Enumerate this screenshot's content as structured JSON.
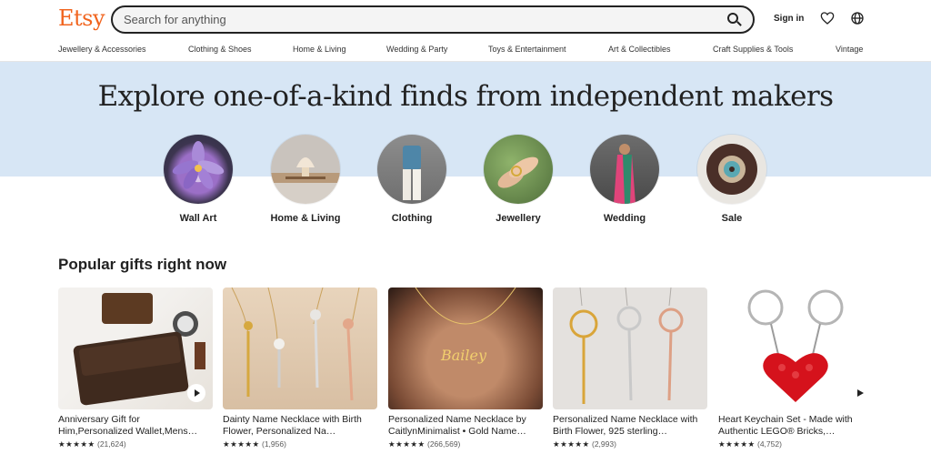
{
  "header": {
    "logo": "Etsy",
    "search_placeholder": "Search for anything",
    "sign_in": "Sign in"
  },
  "nav": [
    "Jewellery & Accessories",
    "Clothing & Shoes",
    "Home & Living",
    "Wedding & Party",
    "Toys & Entertainment",
    "Art & Collectibles",
    "Craft Supplies & Tools",
    "Vintage"
  ],
  "hero": {
    "title": "Explore one-of-a-kind finds from independent makers",
    "categories": [
      "Wall Art",
      "Home & Living",
      "Clothing",
      "Jewellery",
      "Wedding",
      "Sale"
    ]
  },
  "popular": {
    "title": "Popular gifts right now",
    "items": [
      {
        "title": "Anniversary Gift for Him,Personalized Wallet,Mens…",
        "stars": "★★★★★",
        "count": "(21,624)"
      },
      {
        "title": "Dainty Name Necklace with Birth Flower, Personalized Na…",
        "stars": "★★★★★",
        "count": "(1,956)"
      },
      {
        "title": "Personalized Name Necklace by CaitlynMinimalist • Gold Name…",
        "stars": "★★★★★",
        "count": "(266,569)"
      },
      {
        "title": "Personalized Name Necklace with Birth Flower, 925 sterling…",
        "stars": "★★★★★",
        "count": "(2,993)"
      },
      {
        "title": "Heart Keychain Set - Made with Authentic LEGO® Bricks,…",
        "stars": "★★★★★",
        "count": "(4,752)"
      }
    ]
  },
  "colors": {
    "brand": "#F1641E",
    "hero_bg": "#d7e6f5"
  }
}
